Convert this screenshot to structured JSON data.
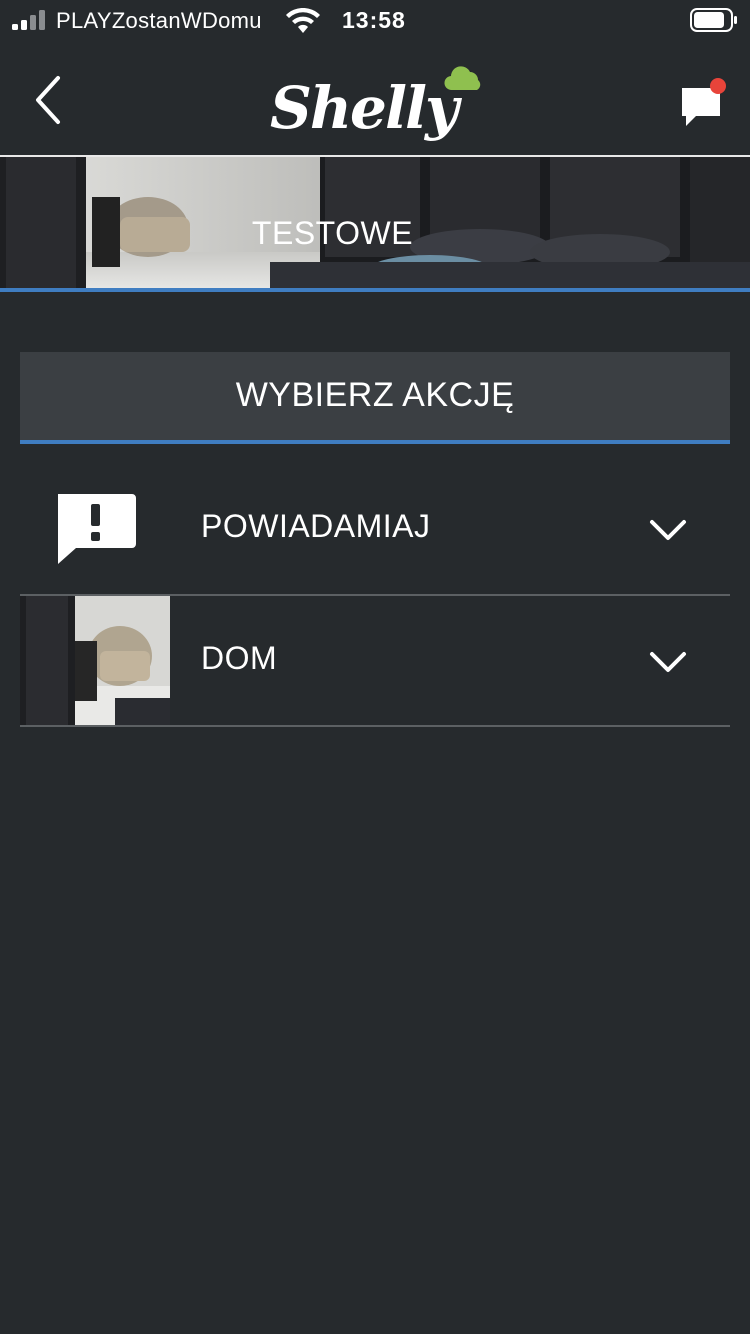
{
  "status_bar": {
    "carrier": "PLAYZostanWDomu",
    "time": "13:58"
  },
  "nav": {
    "logo_text": "Shelly",
    "colors": {
      "logo_cloud": "#8fc04f",
      "notification_dot": "#e8443a"
    }
  },
  "banner": {
    "title": "TESTOWE"
  },
  "section": {
    "title": "WYBIERZ AKCJĘ"
  },
  "rows": [
    {
      "label": "POWIADAMIAJ",
      "icon": "alert-message-icon"
    },
    {
      "label": "DOM",
      "icon": "room-thumbnail"
    }
  ],
  "colors": {
    "background": "#262a2d",
    "accent": "#3f7dc1",
    "section_bg": "#3b3f43"
  }
}
